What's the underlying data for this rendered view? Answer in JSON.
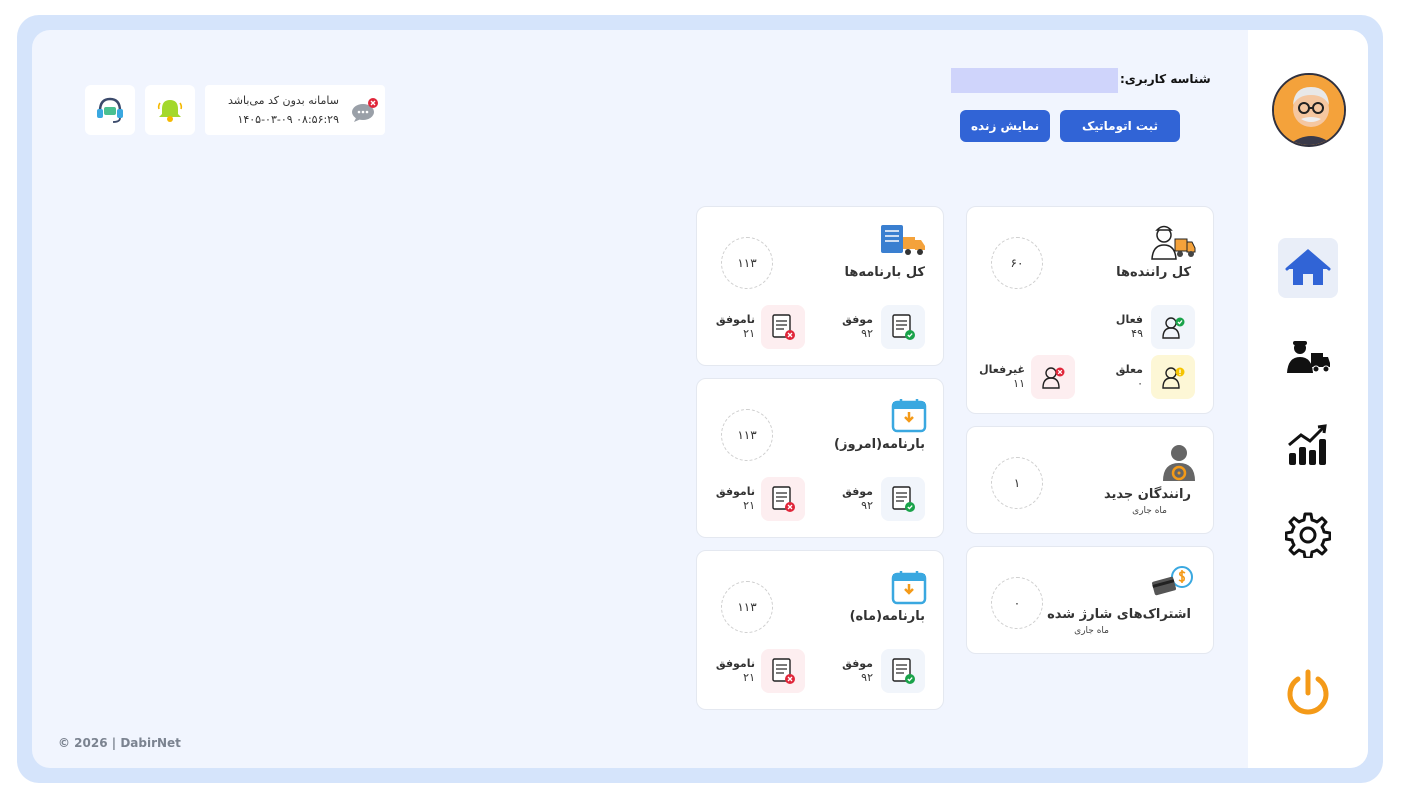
{
  "header": {
    "user_id_label": "شناسه کاربری:",
    "user_id_value": "",
    "auto_register_label": "ثبت اتوماتیک",
    "live_view_label": "نمایش زنده",
    "notice_text": "سامانه بدون کد می‌باشد",
    "notice_datetime": "۱۴۰۵-۰۳-۰۹ ۰۸:۵۶:۲۹"
  },
  "sidebar": {
    "items": [
      {
        "name": "home",
        "icon": "home-icon"
      },
      {
        "name": "drivers",
        "icon": "driver-truck-icon"
      },
      {
        "name": "reports",
        "icon": "chart-icon"
      },
      {
        "name": "settings",
        "icon": "gear-icon"
      },
      {
        "name": "logout",
        "icon": "power-icon"
      }
    ]
  },
  "drivers_card": {
    "title": "کل راننده‌ها",
    "total": "۶۰",
    "active_label": "فعال",
    "active_value": "۴۹",
    "suspended_label": "معلق",
    "suspended_value": "۰",
    "inactive_label": "غیرفعال",
    "inactive_value": "۱۱"
  },
  "new_drivers_card": {
    "title": "رانندگان جدید",
    "subtitle": "ماه جاری",
    "total": "۱"
  },
  "subscriptions_card": {
    "title": "اشتراک‌های شارژ شده",
    "subtitle": "ماه جاری",
    "total": "۰"
  },
  "bills_total_card": {
    "title": "کل بارنامه‌ها",
    "total": "۱۱۳",
    "success_label": "موفق",
    "success_value": "۹۲",
    "fail_label": "ناموفق",
    "fail_value": "۲۱"
  },
  "bills_today_card": {
    "title": "بارنامه(امروز)",
    "total": "۱۱۳",
    "success_label": "موفق",
    "success_value": "۹۲",
    "fail_label": "ناموفق",
    "fail_value": "۲۱"
  },
  "bills_month_card": {
    "title": "بارنامه(ماه)",
    "total": "۱۱۳",
    "success_label": "موفق",
    "success_value": "۹۲",
    "fail_label": "ناموفق",
    "fail_value": "۲۱"
  },
  "footer": {
    "copyright": "© 2026 | DabirNet"
  },
  "colors": {
    "primary": "#3164d6",
    "frame": "#d5e4fb",
    "panel": "#f1f5fe",
    "power": "#f49a18",
    "success": "#1aa34a",
    "fail": "#e0263a"
  }
}
